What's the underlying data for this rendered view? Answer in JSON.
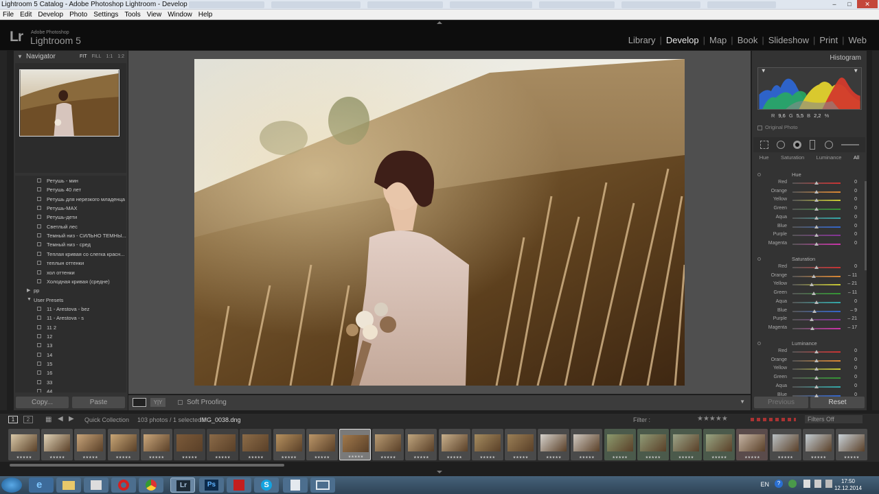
{
  "window": {
    "title": "Lightroom 5 Catalog - Adobe Photoshop Lightroom - Develop"
  },
  "menu": [
    "File",
    "Edit",
    "Develop",
    "Photo",
    "Settings",
    "Tools",
    "View",
    "Window",
    "Help"
  ],
  "brand": {
    "logo": "Lr",
    "adobe": "Adobe Photoshop",
    "name": "Lightroom 5"
  },
  "modules": [
    {
      "label": "Library",
      "active": false
    },
    {
      "label": "Develop",
      "active": true
    },
    {
      "label": "Map",
      "active": false
    },
    {
      "label": "Book",
      "active": false
    },
    {
      "label": "Slideshow",
      "active": false
    },
    {
      "label": "Print",
      "active": false
    },
    {
      "label": "Web",
      "active": false
    }
  ],
  "navigator": {
    "title": "Navigator",
    "options": [
      "FIT",
      "FILL",
      "1:1",
      "1:2"
    ]
  },
  "presets": [
    {
      "label": "Ретушь - мин",
      "kind": "item"
    },
    {
      "label": "Ретушь 40 лет",
      "kind": "item"
    },
    {
      "label": "Ретушь для нерезкого младенца",
      "kind": "item"
    },
    {
      "label": "Ретушь-MAX",
      "kind": "item"
    },
    {
      "label": "Ретушь-дети",
      "kind": "item"
    },
    {
      "label": "Светлый лес",
      "kind": "item"
    },
    {
      "label": "Темный низ - СИЛЬНО ТЕМНЫ...",
      "kind": "item"
    },
    {
      "label": "Темный низ - сред",
      "kind": "item"
    },
    {
      "label": "Теплая кривая со слегка красн...",
      "kind": "item"
    },
    {
      "label": "теплын оттенки",
      "kind": "item"
    },
    {
      "label": "хол оттенки",
      "kind": "item"
    },
    {
      "label": "Холодная кривая (средне)",
      "kind": "item"
    },
    {
      "label": "pp",
      "kind": "folder-closed"
    },
    {
      "label": "User Presets",
      "kind": "folder-open"
    },
    {
      "label": "11 - Arestova - bez",
      "kind": "item"
    },
    {
      "label": "11 - Arestova - s",
      "kind": "item"
    },
    {
      "label": "11 2",
      "kind": "item"
    },
    {
      "label": "12",
      "kind": "item"
    },
    {
      "label": "13",
      "kind": "item"
    },
    {
      "label": "14",
      "kind": "item"
    },
    {
      "label": "15",
      "kind": "item"
    },
    {
      "label": "16",
      "kind": "item"
    },
    {
      "label": "33",
      "kind": "item"
    },
    {
      "label": "44",
      "kind": "item"
    }
  ],
  "left_buttons": {
    "copy": "Copy...",
    "paste": "Paste"
  },
  "toolbar": {
    "soft_proofing": "Soft Proofing"
  },
  "histogram": {
    "title": "Histogram",
    "r_label": "R",
    "r_value": "9,6",
    "g_label": "G",
    "g_value": "5,5",
    "b_label": "B",
    "b_value": "2,2",
    "percent": "%",
    "original_photo": "Original Photo"
  },
  "hsl": {
    "tabs": [
      {
        "label": "Hue",
        "active": false
      },
      {
        "label": "Saturation",
        "active": false
      },
      {
        "label": "Luminance",
        "active": false
      },
      {
        "label": "All",
        "active": true
      }
    ],
    "sections": [
      {
        "title": "Hue",
        "rows": [
          {
            "label": "Red",
            "value": "0"
          },
          {
            "label": "Orange",
            "value": "0"
          },
          {
            "label": "Yellow",
            "value": "0"
          },
          {
            "label": "Green",
            "value": "0"
          },
          {
            "label": "Aqua",
            "value": "0"
          },
          {
            "label": "Blue",
            "value": "0"
          },
          {
            "label": "Purple",
            "value": "0"
          },
          {
            "label": "Magenta",
            "value": "0"
          }
        ]
      },
      {
        "title": "Saturation",
        "rows": [
          {
            "label": "Red",
            "value": "0"
          },
          {
            "label": "Orange",
            "value": "– 11"
          },
          {
            "label": "Yellow",
            "value": "– 21"
          },
          {
            "label": "Green",
            "value": "– 11"
          },
          {
            "label": "Aqua",
            "value": "0"
          },
          {
            "label": "Blue",
            "value": "– 9"
          },
          {
            "label": "Purple",
            "value": "– 21"
          },
          {
            "label": "Magenta",
            "value": "– 17"
          }
        ]
      },
      {
        "title": "Luminance",
        "rows": [
          {
            "label": "Red",
            "value": "0"
          },
          {
            "label": "Orange",
            "value": "0"
          },
          {
            "label": "Yellow",
            "value": "0"
          },
          {
            "label": "Green",
            "value": "0"
          },
          {
            "label": "Aqua",
            "value": "0"
          },
          {
            "label": "Blue",
            "value": "0"
          }
        ]
      }
    ]
  },
  "right_buttons": {
    "previous": "Previous",
    "reset": "Reset"
  },
  "filmbar": {
    "page1": "1",
    "page2": "2",
    "collection": "Quick Collection",
    "info": "103 photos / 1 selected /",
    "filename": "IMG_0038.dng",
    "filter_label": "Filter :",
    "filter_value": "Filters Off"
  },
  "filmstrip_stars": "★★★★★",
  "filter_stars": "★★★★★",
  "taskbar": {
    "lang": "EN",
    "time": "17:50",
    "date": "12.12.2014"
  },
  "colors": {
    "accent": "#e8e8e8",
    "panel": "#333333",
    "bg": "#1e1e1e"
  }
}
